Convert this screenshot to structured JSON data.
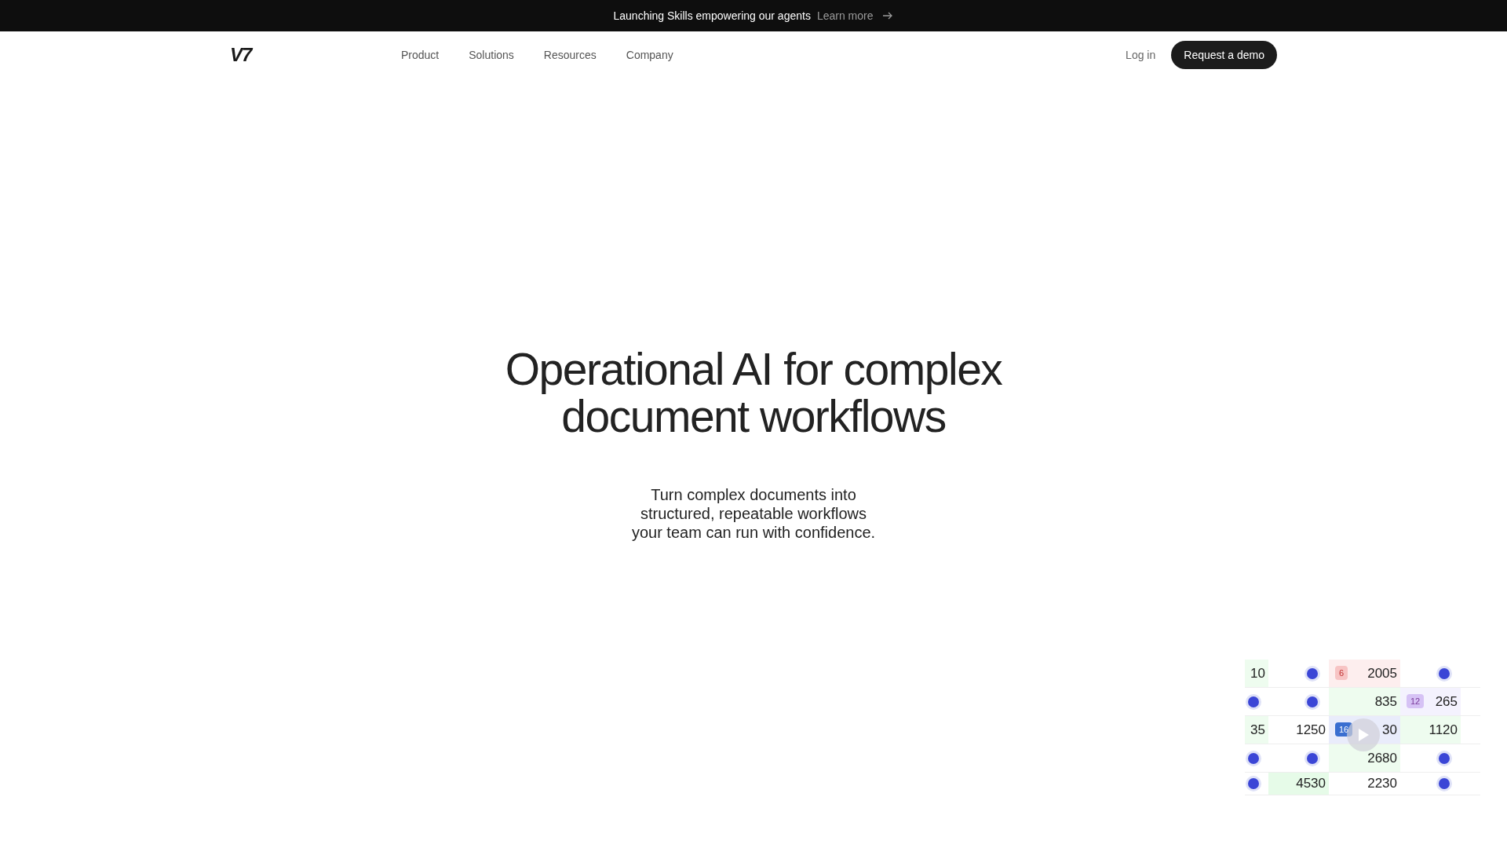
{
  "announcement": {
    "text": "Launching Skills empowering our agents",
    "link": "Learn more"
  },
  "nav": {
    "logo": "V7",
    "links": [
      "Product",
      "Solutions",
      "Resources",
      "Company"
    ],
    "login": "Log in",
    "cta": "Request a demo"
  },
  "hero": {
    "title": "Operational AI for complex document workflows",
    "subtitle": "Turn complex documents into structured, repeatable workflows your team can run with confidence."
  },
  "preview": {
    "rows": [
      [
        {
          "kind": "number",
          "text": "10",
          "color": "#eefcef"
        },
        {
          "kind": "dot"
        },
        {
          "kind": "number",
          "text": "2005",
          "color": "#fdeeee",
          "badge": {
            "text": "6",
            "color": "#f7c4c4"
          }
        },
        {
          "kind": "dot"
        },
        {
          "kind": "blank"
        }
      ],
      [
        {
          "kind": "dot"
        },
        {
          "kind": "dot"
        },
        {
          "kind": "number",
          "text": "835",
          "color": "#eefcef"
        },
        {
          "kind": "number",
          "text": "265",
          "color": "#f4f2fe",
          "badge": {
            "text": "12",
            "color": "#d6c2f5"
          }
        },
        {
          "kind": "blank"
        }
      ],
      [
        {
          "kind": "number",
          "text": "35",
          "color": "#eefcef"
        },
        {
          "kind": "number",
          "text": "1250"
        },
        {
          "kind": "number",
          "text": "30",
          "color": "#e9ecfb",
          "badge": {
            "text": "16",
            "color": "#3a6fd0"
          }
        },
        {
          "kind": "number",
          "text": "1120",
          "color": "#eefcef"
        },
        {
          "kind": "blank"
        }
      ],
      [
        {
          "kind": "dot"
        },
        {
          "kind": "dot"
        },
        {
          "kind": "number",
          "text": "2680",
          "color": "#eefcef"
        },
        {
          "kind": "dot"
        },
        {
          "kind": "blank"
        }
      ],
      [
        {
          "kind": "dot"
        },
        {
          "kind": "number",
          "text": "4530",
          "color": "#e6fbe8"
        },
        {
          "kind": "number",
          "text": "2230"
        },
        {
          "kind": "dot"
        },
        {
          "kind": "blank"
        }
      ]
    ]
  }
}
